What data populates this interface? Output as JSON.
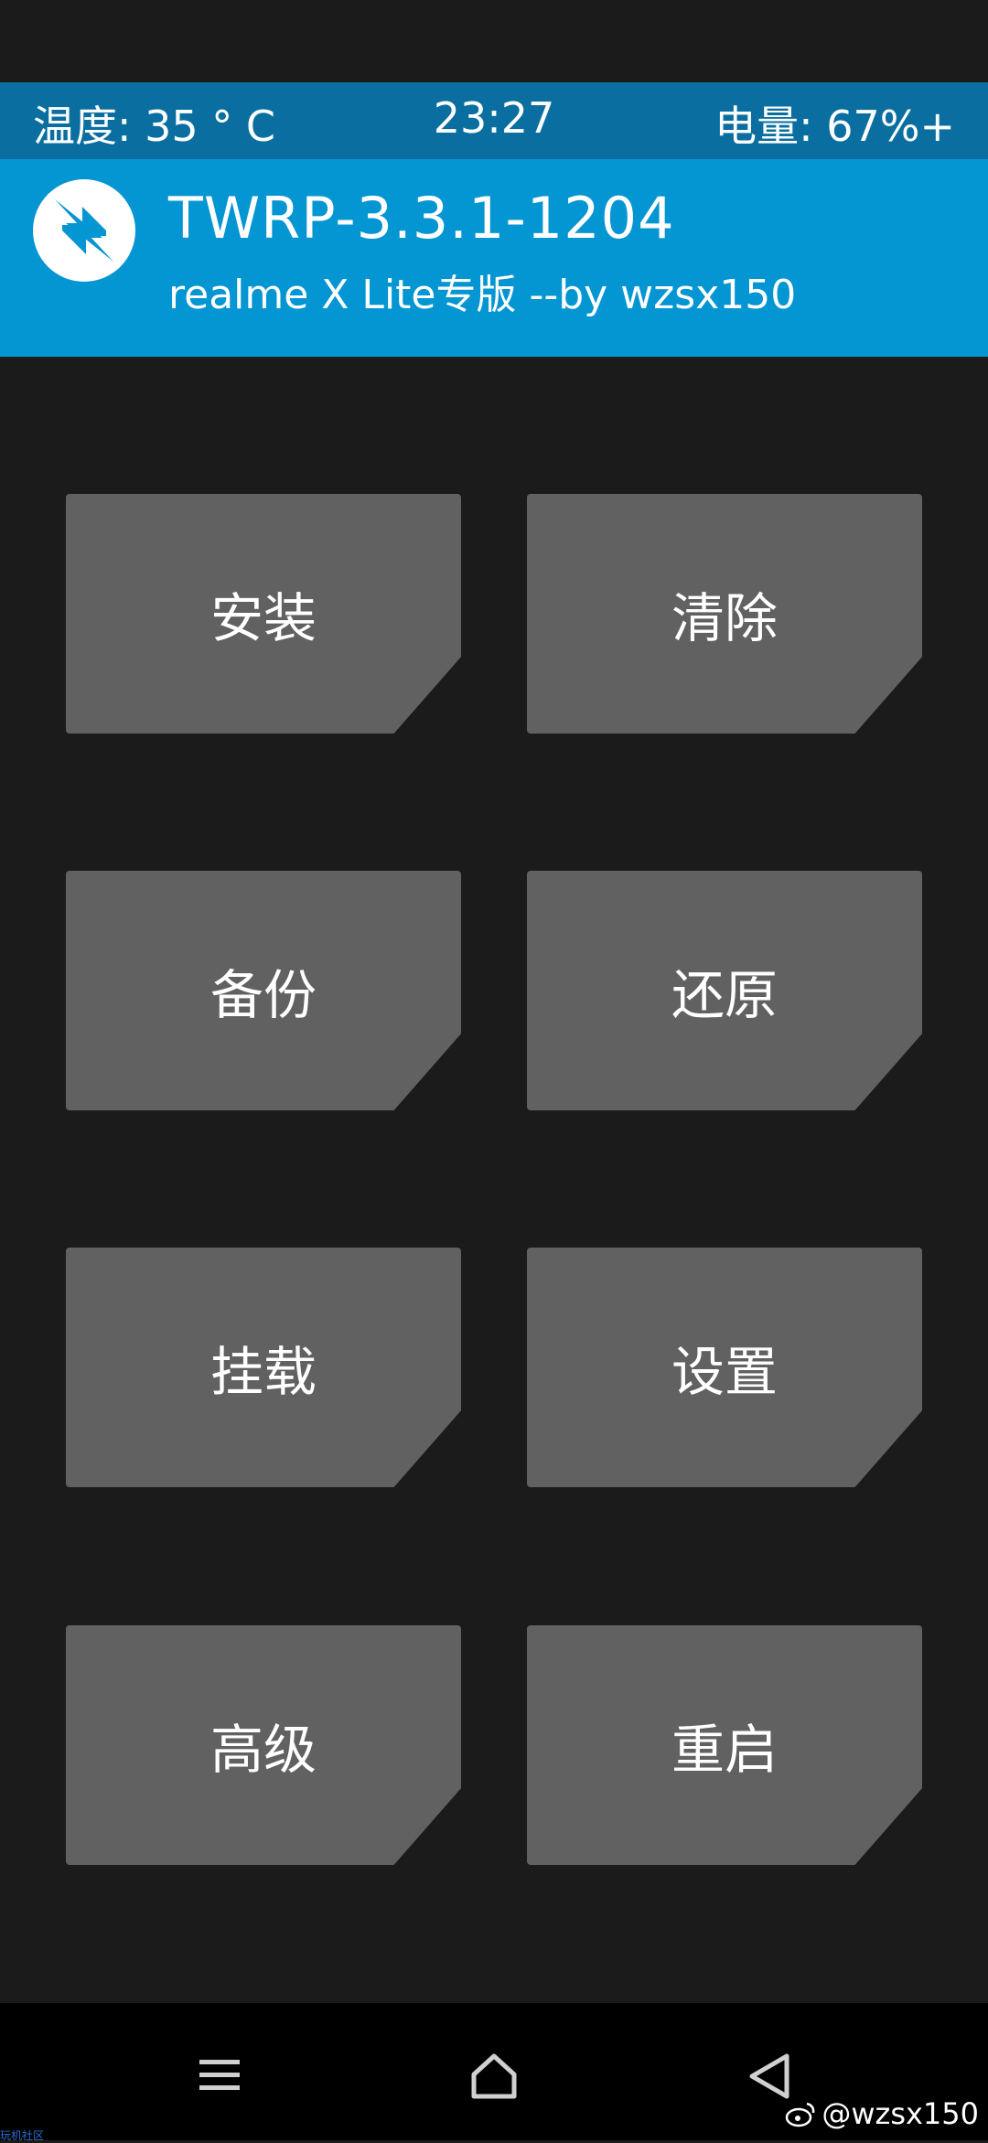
{
  "status": {
    "temperature": "温度: 35 ° C",
    "time": "23:27",
    "battery": "电量: 67%+"
  },
  "header": {
    "title": "TWRP-3.3.1-1204",
    "subtitle": "realme X Lite专版  --by wzsx150",
    "logo_icon": "twrp-logo-icon"
  },
  "buttons": [
    {
      "label": "安装"
    },
    {
      "label": "清除"
    },
    {
      "label": "备份"
    },
    {
      "label": "还原"
    },
    {
      "label": "挂载"
    },
    {
      "label": "设置"
    },
    {
      "label": "高级"
    },
    {
      "label": "重启"
    }
  ],
  "nav": {
    "menu_icon": "menu-icon",
    "home_icon": "home-icon",
    "back_icon": "back-icon"
  },
  "watermark": {
    "text": "@wzsx150",
    "icon": "weibo-icon"
  },
  "corner_tag": "玩机社区",
  "colors": {
    "status_bar": "#0a6fa0",
    "header": "#0495d3",
    "button": "#616161",
    "background": "#1b1b1b"
  }
}
